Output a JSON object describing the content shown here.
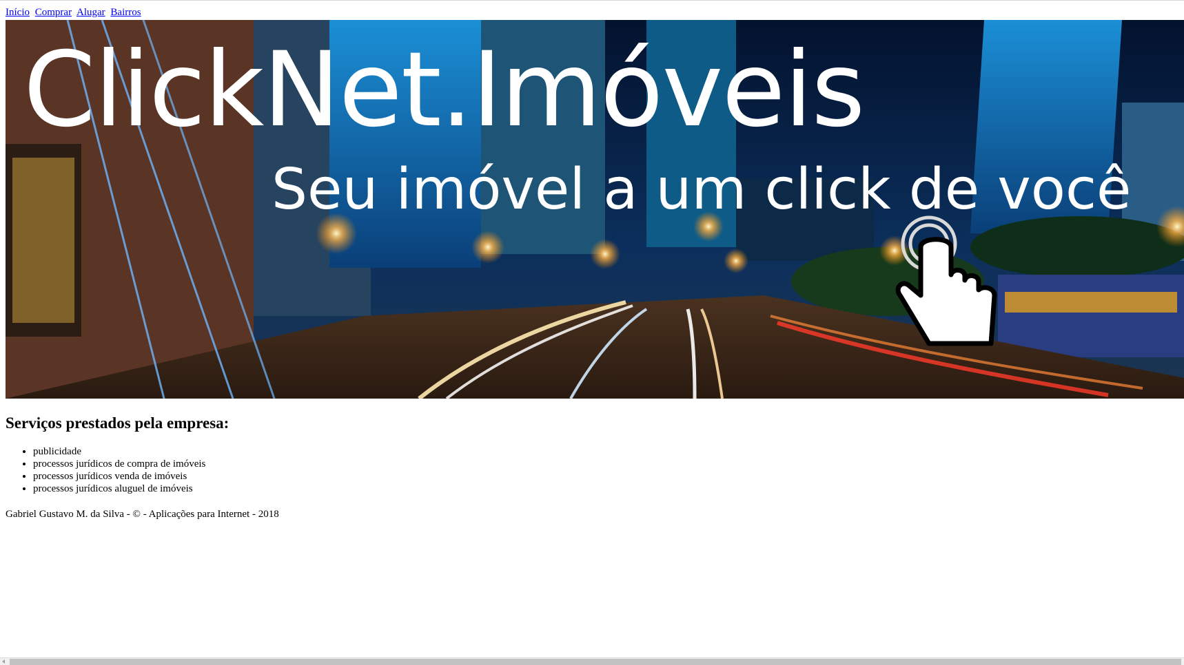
{
  "nav": {
    "links": [
      "Início",
      "Comprar",
      "Alugar",
      "Bairros"
    ]
  },
  "hero": {
    "title": "ClickNet.Imóveis",
    "subtitle": "Seu imóvel a um click de você",
    "image_description_icon": "hand-pointer-icon"
  },
  "services": {
    "heading": "Serviços prestados pela empresa:",
    "items": [
      "publicidade",
      "processos jurídicos de compra de imóveis",
      "processos jurídicos venda de imóveis",
      "processos jurídicos aluguel de imóveis"
    ]
  },
  "footer": {
    "text": "Gabriel Gustavo M. da Silva - © - Aplicações para Internet - 2018"
  },
  "colors": {
    "link": "#0000ee",
    "hero_text": "#ffffff",
    "sky": "#061a3a",
    "city_lights": "#ffb347"
  }
}
